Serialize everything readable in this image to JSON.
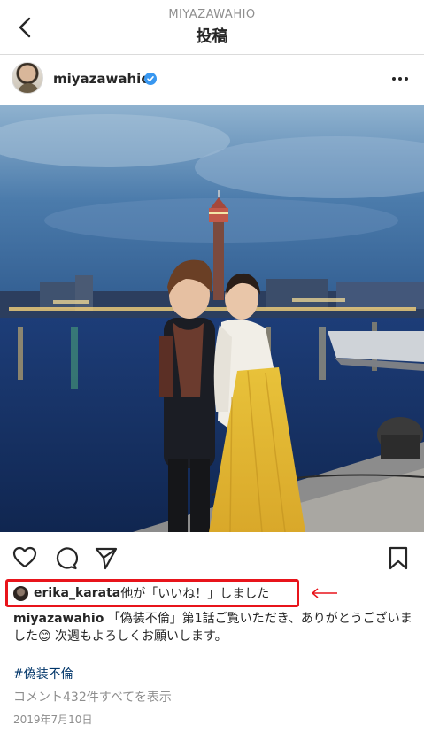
{
  "header": {
    "account": "MIYAZAWAHIO",
    "title": "投稿"
  },
  "post": {
    "username": "miyazawahio",
    "verified": true
  },
  "likes": {
    "liker": "erika_karata",
    "rest": "他が「いいね！」しました"
  },
  "caption": {
    "user": "miyazawahio",
    "text_1": " 「偽装不倫」第1話ご覧いただき、ありがとうございました",
    "emoji": "😊",
    "text_2": " 次週もよろしくお願いします。"
  },
  "hashtag": "#偽装不倫",
  "comments_link": "コメント432件すべてを表示",
  "date": "2019年7月10日",
  "colors": {
    "highlight_box": "#e8141b",
    "verified_badge": "#3897f0",
    "hashtag": "#003569",
    "muted": "#8e8e8e"
  },
  "icons": [
    "back-chevron-icon",
    "verified-badge-icon",
    "more-options-icon",
    "heart-icon",
    "comment-icon",
    "share-icon",
    "bookmark-icon",
    "red-arrow-icon"
  ]
}
